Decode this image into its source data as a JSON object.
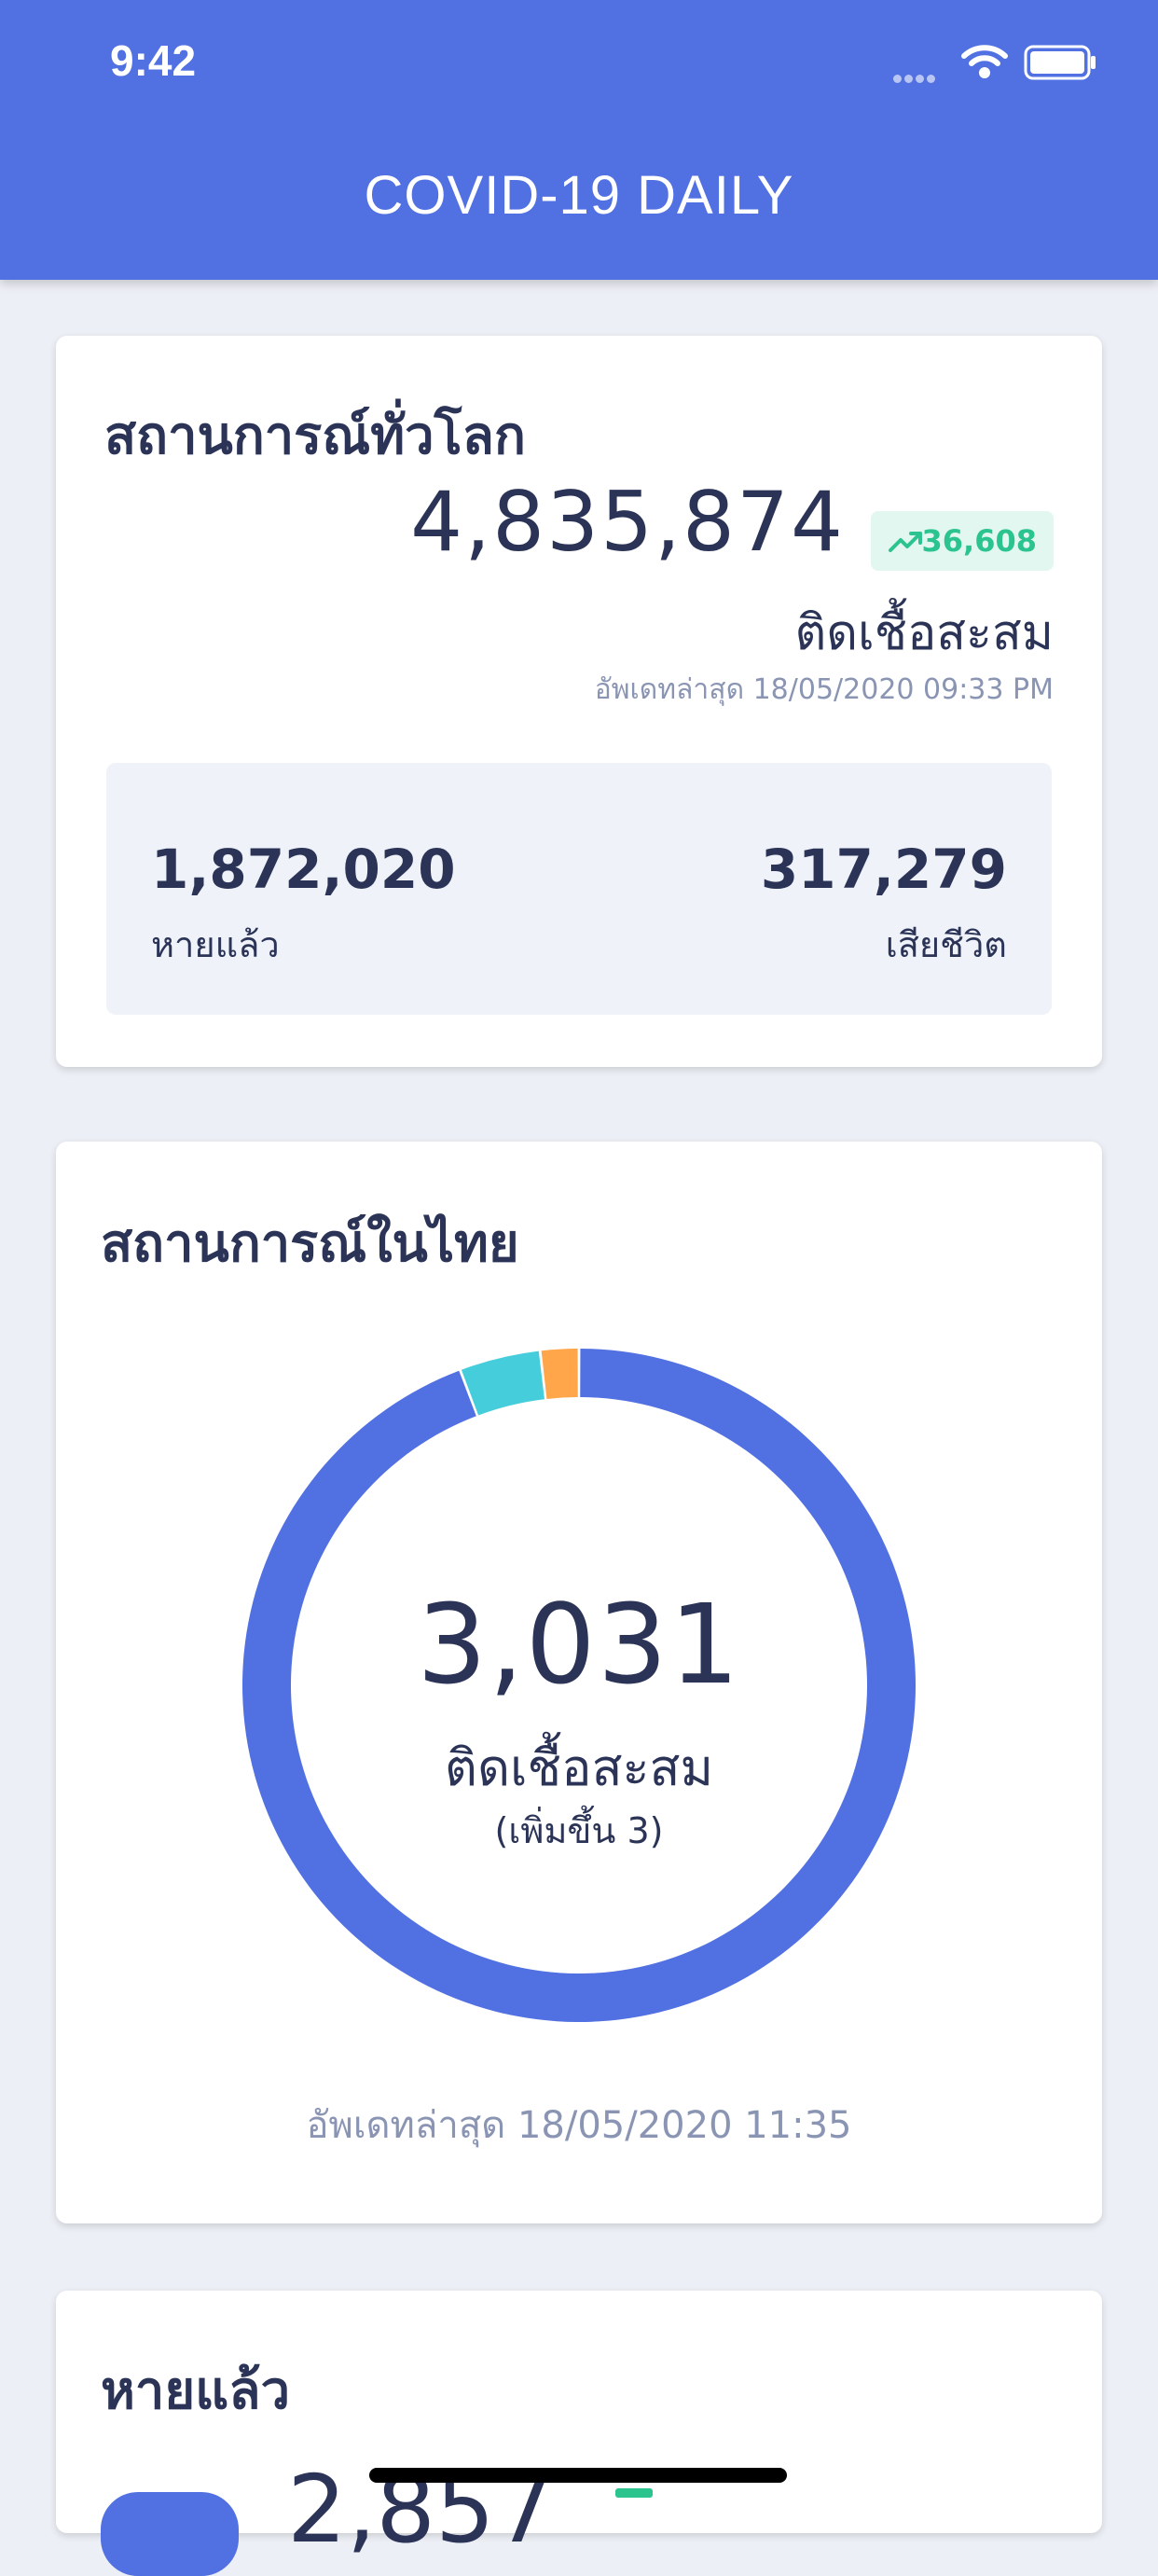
{
  "status_bar": {
    "time": "9:42"
  },
  "app": {
    "title": "COVID-19 DAILY"
  },
  "world": {
    "title": "สถานการณ์ทั่วโลก",
    "confirmed": "4,835,874",
    "confirmed_change": "36,608",
    "confirmed_label": "ติดเชื้อสะสม",
    "updated": "อัพเดทล่าสุด 18/05/2020 09:33 PM",
    "recovered": "1,872,020",
    "recovered_label": "หายแล้ว",
    "deaths": "317,279",
    "deaths_label": "เสียชีวิต"
  },
  "thailand": {
    "title": "สถานการณ์ในไทย",
    "confirmed": "3,031",
    "confirmed_label": "ติดเชื้อสะสม",
    "confirmed_change": "(เพิ่มขึ้น 3)",
    "updated": "อัพเดทล่าสุด 18/05/2020 11:35"
  },
  "chart_data": {
    "type": "pie",
    "values": [
      2857,
      118,
      56
    ],
    "colors": [
      "#5170e2",
      "#45cddb",
      "#ffa64a"
    ]
  },
  "recovered_card": {
    "title": "หายแล้ว",
    "value": "2,857"
  },
  "colors": {
    "primary": "#5170e2",
    "text": "#2b3457",
    "muted": "#8a94b3",
    "positive": "#2bc48f",
    "background": "#eceff5"
  }
}
